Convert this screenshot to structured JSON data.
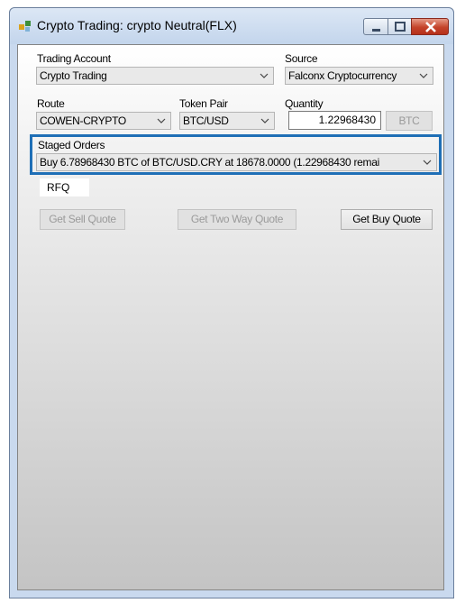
{
  "window": {
    "title": "Crypto Trading: crypto Neutral(FLX)"
  },
  "form": {
    "trading_account_label": "Trading Account",
    "trading_account_value": "Crypto Trading",
    "source_label": "Source",
    "source_value": "Falconx Cryptocurrency",
    "route_label": "Route",
    "route_value": "COWEN-CRYPTO",
    "token_pair_label": "Token Pair",
    "token_pair_value": "BTC/USD",
    "quantity_label": "Quantity",
    "quantity_value": "1.22968430",
    "currency_button": "BTC",
    "staged_orders_label": "Staged Orders",
    "staged_orders_value": "Buy 6.78968430 BTC of BTC/USD.CRY at 18678.0000 (1.22968430 remai"
  },
  "rfq": {
    "tab_label": "RFQ",
    "sell_quote": "Get Sell Quote",
    "two_way_quote": "Get Two Way Quote",
    "buy_quote": "Get Buy Quote"
  },
  "colors": {
    "highlight": "#1f6fb6",
    "close_button": "#c4432a"
  }
}
